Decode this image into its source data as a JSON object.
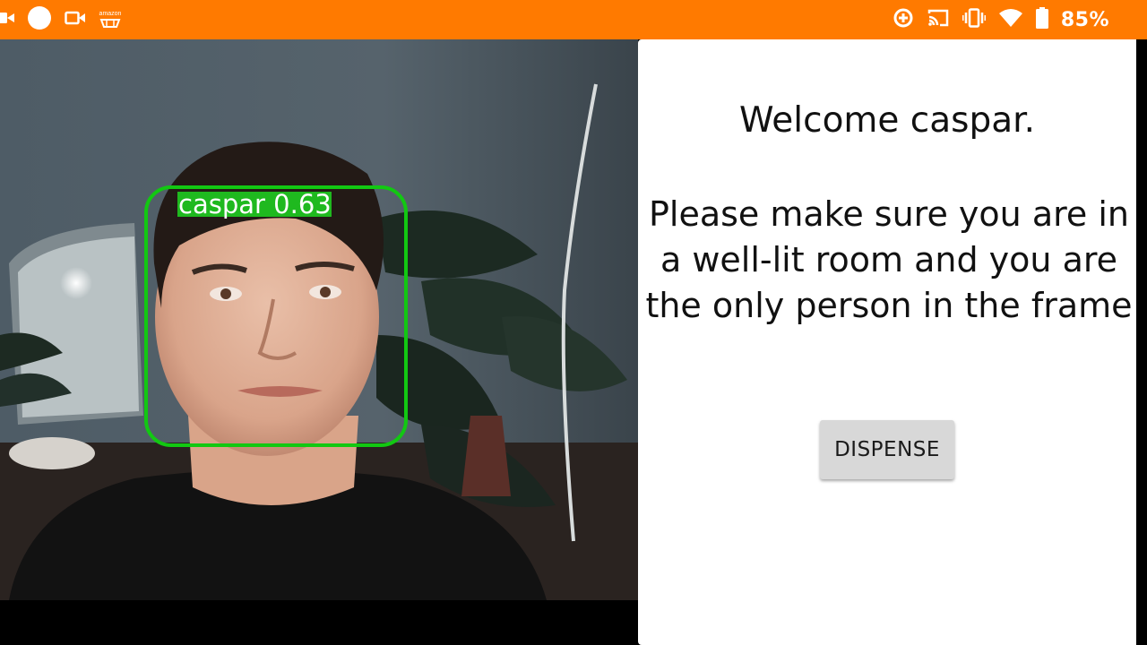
{
  "status_bar": {
    "background": "#ff7a00",
    "left_icons": [
      "video-camera-icon",
      "record-dot-icon",
      "video-camera-icon",
      "amazon-prime-icon"
    ],
    "amazon_icon_text": "amazon",
    "right_icons": [
      "data-saver-icon",
      "cast-icon",
      "vibrate-icon",
      "wifi-icon",
      "battery-icon"
    ],
    "battery_percent": "85%"
  },
  "camera": {
    "detection_label": "caspar 0.63",
    "box_color": "#12c812"
  },
  "panel": {
    "welcome_text": "Welcome caspar.",
    "instruction_text": "Please make sure you are in a well-lit room and you are the only person in the frame",
    "dispense_label": "DISPENSE"
  }
}
